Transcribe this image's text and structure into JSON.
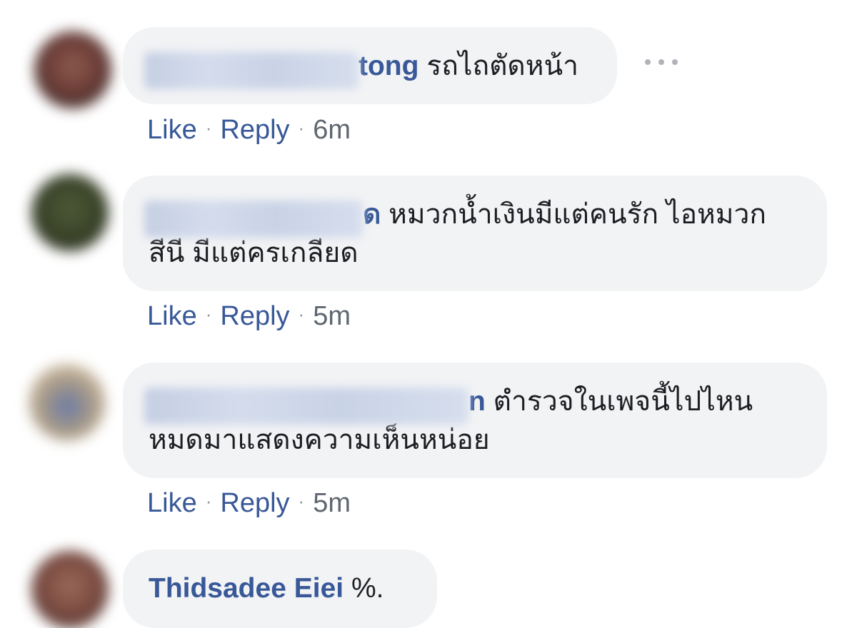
{
  "comments": [
    {
      "author_suffix": "tong",
      "text": "รถไถตัดหน้า",
      "text_line2": "",
      "like": "Like",
      "reply": "Reply",
      "time": "6m",
      "avatar_color": "#7a4a42"
    },
    {
      "author_suffix": "ด",
      "text": "หมวกน้ำเงินมีแต่คนรัก ไอหมวก",
      "text_line2": "สีนี มีแต่ครเกลียด",
      "like": "Like",
      "reply": "Reply",
      "time": "5m",
      "avatar_color": "#3f4a2e"
    },
    {
      "author_suffix": "n",
      "text": "ตำรวจในเพจนี้ไปไหน",
      "text_line2": "หมดมาแสดงความเห็นหน่อย",
      "like": "Like",
      "reply": "Reply",
      "time": "5m",
      "avatar_color": "#b89a7a"
    },
    {
      "author": "Thidsadee Eiei",
      "text": "%.",
      "avatar_color": "#8a5a4e"
    }
  ],
  "more_icon": "ellipsis-icon",
  "colors": {
    "link": "#385898",
    "bubble": "#f2f3f5",
    "meta": "#606770"
  }
}
